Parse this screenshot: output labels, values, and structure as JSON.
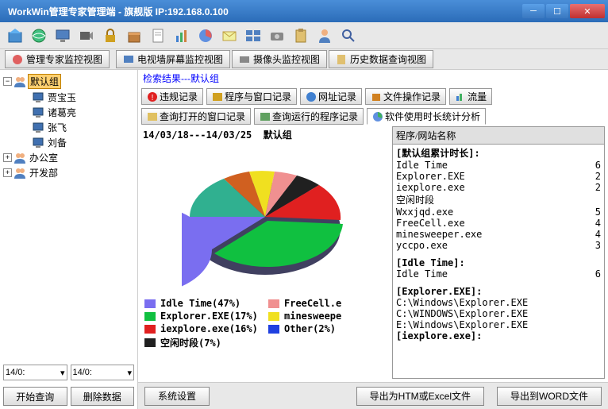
{
  "window": {
    "title": "WorkWin管理专家管理端 - 旗舰版 IP:192.168.0.100"
  },
  "view_tabs": [
    {
      "label": "管理专家监控视图"
    },
    {
      "label": "电视墙屏幕监控视图"
    },
    {
      "label": "摄像头监控视图"
    },
    {
      "label": "历史数据查询视图"
    }
  ],
  "tree": {
    "root": "默认组",
    "children": [
      "贾宝玉",
      "诸葛亮",
      "张飞",
      "刘备"
    ],
    "other": [
      "办公室",
      "开发部"
    ]
  },
  "dates": {
    "from": "14/0:",
    "to": "14/0:"
  },
  "side_buttons": {
    "query": "开始查询",
    "delete": "删除数据"
  },
  "search_result": "检索结果---默认组",
  "filter_tabs": {
    "row1": [
      "违规记录",
      "程序与窗口记录",
      "网址记录",
      "文件操作记录",
      "流量"
    ],
    "row2": [
      "查询打开的窗口记录",
      "查询运行的程序记录",
      "软件使用时长统计分析"
    ]
  },
  "chart_header_date": "14/03/18---14/03/25",
  "chart_header_group": "默认组",
  "list_header": "程序/网站名称",
  "list": {
    "group_header": "[默认组累计时长]:",
    "items": [
      {
        "name": "Idle Time",
        "val": "6"
      },
      {
        "name": "Explorer.EXE",
        "val": "2"
      },
      {
        "name": "iexplore.exe",
        "val": "2"
      },
      {
        "name": "空闲时段",
        "val": ""
      },
      {
        "name": "Wxxjqd.exe",
        "val": "5"
      },
      {
        "name": "FreeCell.exe",
        "val": "4"
      },
      {
        "name": "minesweeper.exe",
        "val": "4"
      },
      {
        "name": "yccpo.exe",
        "val": "3"
      }
    ],
    "idle_header": "[Idle Time]:",
    "idle_item": "Idle Time",
    "idle_val": "6",
    "explorer_header": "[Explorer.EXE]:",
    "explorer_items": [
      "C:\\Windows\\Explorer.EXE",
      "C:\\WINDOWS\\Explorer.EXE",
      "E:\\Windows\\Explorer.EXE"
    ],
    "iexplore_header": "[iexplore.exe]:"
  },
  "chart_data": {
    "type": "pie",
    "title": "",
    "series": [
      {
        "name": "Idle Time",
        "pct": 47,
        "color": "#7a6ef0"
      },
      {
        "name": "Explorer.EXE",
        "pct": 17,
        "color": "#10c040"
      },
      {
        "name": "iexplore.exe",
        "pct": 16,
        "color": "#e02020"
      },
      {
        "name": "空闲时段",
        "pct": 7,
        "color": "#202020"
      },
      {
        "name": "FreeCell.e",
        "pct": 5,
        "color": "#f09090"
      },
      {
        "name": "minesweepe",
        "pct": 4,
        "color": "#f0e020"
      },
      {
        "name": "Other",
        "pct": 2,
        "color": "#2040e0"
      }
    ],
    "legend_labels": {
      "l0": "Idle Time(47%)",
      "l1": "Explorer.EXE(17%)",
      "l2": "iexplore.exe(16%)",
      "l3": "空闲时段(7%)",
      "l4": "FreeCell.e",
      "l5": "minesweepe",
      "l6": "Other(2%)"
    }
  },
  "bottom": {
    "settings": "系统设置",
    "export_excel": "导出为HTM或Excel文件",
    "export_word": "导出到WORD文件"
  }
}
